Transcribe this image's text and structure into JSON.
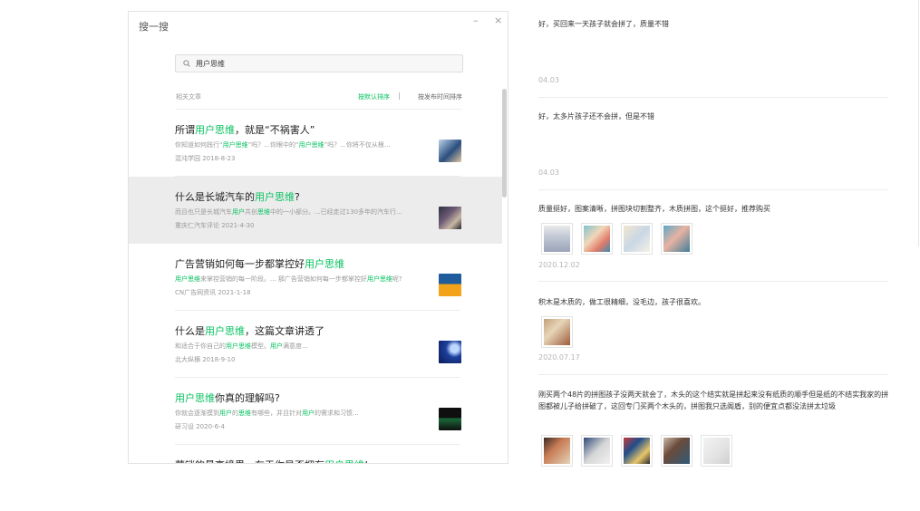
{
  "window": {
    "title": "搜一搜",
    "minimize": "–",
    "close": "×"
  },
  "search": {
    "value": "用户思维",
    "placeholder": ""
  },
  "list_header": {
    "label": "相关文章",
    "sort_default": "按默认排序",
    "separator": "|",
    "sort_time": "按发布时间排序"
  },
  "results": [
    {
      "title": [
        {
          "t": "所谓"
        },
        {
          "t": "用户思维",
          "hl": true
        },
        {
          "t": "，就是“不祸害人”"
        }
      ],
      "snippet": [
        {
          "t": "你知道如何践行“"
        },
        {
          "t": "用户思维",
          "hl": true
        },
        {
          "t": "”吗？...你眼中的“"
        },
        {
          "t": "用户思维",
          "hl": true
        },
        {
          "t": "”吗？...你将不仅从根..."
        }
      ],
      "meta": "混沌学园  2018-8-23"
    },
    {
      "title": [
        {
          "t": "什么是长城汽车的"
        },
        {
          "t": "用户思维",
          "hl": true
        },
        {
          "t": "?"
        }
      ],
      "snippet": [
        {
          "t": "而且也只是长城汽车"
        },
        {
          "t": "用户",
          "hl": true
        },
        {
          "t": "共创"
        },
        {
          "t": "思维",
          "hl": true
        },
        {
          "t": "中的一小部分。...已经走过130多年的汽车行..."
        }
      ],
      "meta": "重庆仁汽车评论  2021-4-30"
    },
    {
      "title": [
        {
          "t": "广告营销如何每一步都掌控好"
        },
        {
          "t": "用户思维",
          "hl": true
        }
      ],
      "snippet": [
        {
          "t": "用户思维",
          "hl": true
        },
        {
          "t": "来掌控营销的每一阶段。... 那广告营销如何每一步都掌控好"
        },
        {
          "t": "用户思维",
          "hl": true
        },
        {
          "t": "呢?"
        }
      ],
      "meta": "CN广告网资讯  2021-1-18"
    },
    {
      "title": [
        {
          "t": "什么是"
        },
        {
          "t": "用户思维",
          "hl": true
        },
        {
          "t": "，这篇文章讲透了"
        }
      ],
      "snippet": [
        {
          "t": "和适合于你自己的"
        },
        {
          "t": "用户思维",
          "hl": true
        },
        {
          "t": "模型。"
        },
        {
          "t": "用户",
          "hl": true
        },
        {
          "t": "满意度..."
        }
      ],
      "meta": "北大纵横  2018-9-10"
    },
    {
      "title": [
        {
          "t": "用户思维",
          "hl": true
        },
        {
          "t": "你真的理解吗?"
        }
      ],
      "snippet": [
        {
          "t": "你就会逐渐摸到"
        },
        {
          "t": "用户",
          "hl": true
        },
        {
          "t": "的"
        },
        {
          "t": "思维",
          "hl": true
        },
        {
          "t": "有哪些，并且针对"
        },
        {
          "t": "用户",
          "hl": true
        },
        {
          "t": "的需求和习惯..."
        }
      ],
      "meta": "研习设  2020-6-4"
    },
    {
      "title": [
        {
          "t": "营销的最高境界，在于你是否拥有"
        },
        {
          "t": "用户思维",
          "hl": true
        },
        {
          "t": "!"
        }
      ],
      "snippet": [],
      "meta": ""
    }
  ],
  "reviews": [
    {
      "text": "好，买回来一天孩子就会拼了，质量不错",
      "date": "04.03",
      "images": 0
    },
    {
      "text": "好，太多片孩子还不会拼，但是不错",
      "date": "04.03",
      "images": 0
    },
    {
      "text": "质量挺好，图案清晰，拼图块切割整齐，木质拼图，这个挺好，推荐购买",
      "date": "2020.12.02",
      "images": 4
    },
    {
      "text": "积木是木质的，做工很精细，没毛边，孩子很喜欢。",
      "date": "2020.07.17",
      "images": 1
    },
    {
      "text": "刚买两个48片的拼图孩子没两天就会了，木头的这个结实就是拼起来没有纸质的顺手但是纸的不结实我家的拼图都被儿子给拼破了，这回专门买两个木头的，拼图我只选阁盾，别的便宜点都没法拼太垃圾",
      "date": "",
      "images": 5
    }
  ]
}
